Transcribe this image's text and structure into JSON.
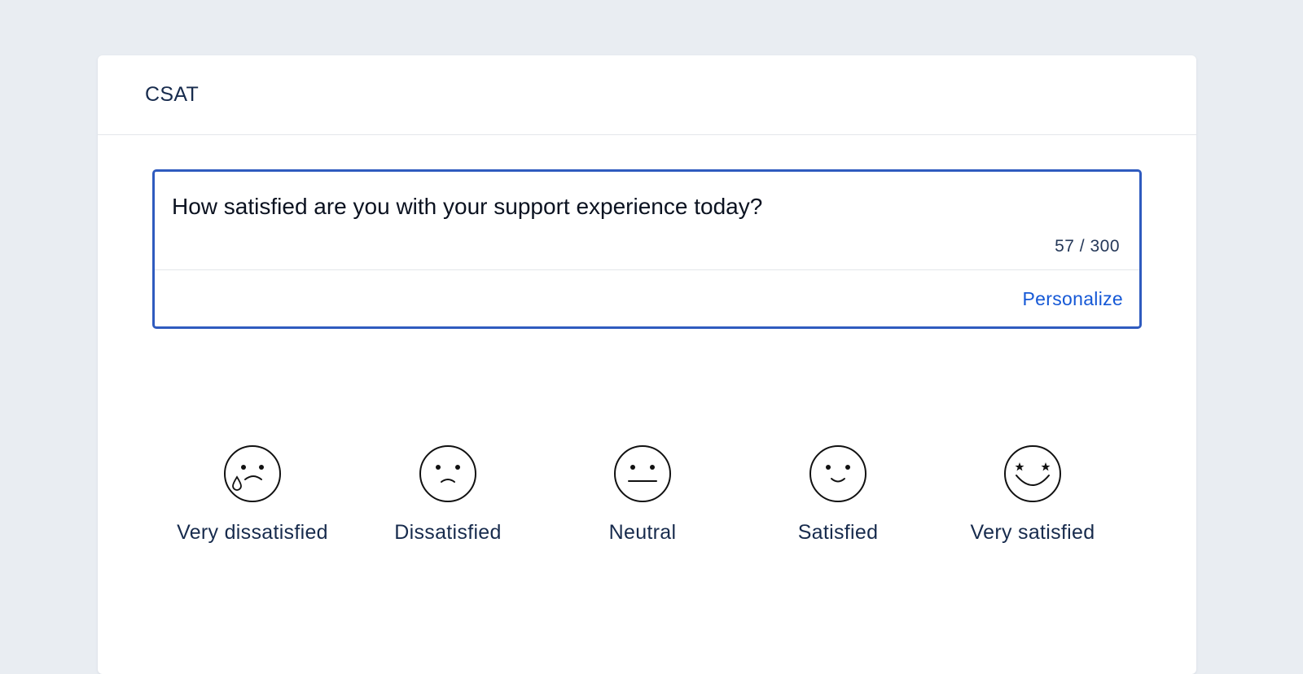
{
  "card": {
    "title": "CSAT"
  },
  "question": {
    "text": "How satisfied are you with your support experience today?",
    "char_count": "57 / 300",
    "personalize_label": "Personalize"
  },
  "ratings": [
    {
      "label": "Very dissatisfied",
      "icon": "crying-face-icon"
    },
    {
      "label": "Dissatisfied",
      "icon": "frowning-face-icon"
    },
    {
      "label": "Neutral",
      "icon": "neutral-face-icon"
    },
    {
      "label": "Satisfied",
      "icon": "smiling-face-icon"
    },
    {
      "label": "Very satisfied",
      "icon": "star-struck-face-icon"
    }
  ],
  "colors": {
    "background": "#e9edf2",
    "card": "#ffffff",
    "focus_border": "#2f5bbf",
    "link": "#1558d6",
    "text_primary": "#172b4d"
  }
}
